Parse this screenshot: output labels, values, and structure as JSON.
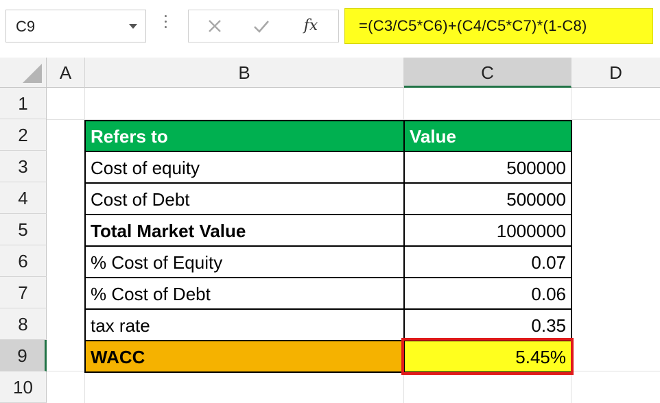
{
  "name_box": {
    "value": "C9"
  },
  "formula_bar": {
    "cancel_icon": "x-icon",
    "enter_icon": "check-icon",
    "fx_label": "fx",
    "formula": "=(C3/C5*C6)+(C4/C5*C7)*(1-C8)"
  },
  "columns": [
    "A",
    "B",
    "C",
    "D"
  ],
  "rows": [
    "1",
    "2",
    "3",
    "4",
    "5",
    "6",
    "7",
    "8",
    "9",
    "10"
  ],
  "selected_cell": "C9",
  "table": {
    "header": {
      "b": "Refers to",
      "c": "Value"
    },
    "body": [
      {
        "b": "Cost of equity",
        "c": "500000"
      },
      {
        "b": "Cost of Debt",
        "c": "500000"
      },
      {
        "b": "Total Market Value",
        "c": "1000000"
      },
      {
        "b": "% Cost of Equity",
        "c": "0.07"
      },
      {
        "b": "% Cost of Debt",
        "c": "0.06"
      },
      {
        "b": "tax rate",
        "c": "0.35"
      },
      {
        "b": "WACC",
        "c": "5.45%"
      }
    ]
  },
  "colors": {
    "header_fill": "#00b050",
    "wacc_fill": "#f5b200",
    "highlight_fill": "#ffff1e",
    "highlight_border": "#e01b1b",
    "selection_accent": "#217346"
  }
}
